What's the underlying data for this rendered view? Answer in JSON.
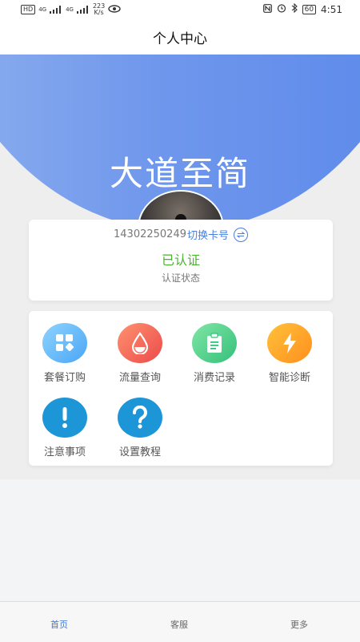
{
  "status_bar": {
    "hd_badge": "HD",
    "net1": "4G",
    "net2": "4G",
    "speed": "223",
    "speed_unit": "K/s",
    "battery": "60",
    "time": "4:51"
  },
  "page_title": "个人中心",
  "hero_title": "大道至简",
  "account": {
    "phone": "14302250249",
    "switch_label": "切换卡号",
    "status_value": "已认证",
    "status_label": "认证状态"
  },
  "menu": [
    {
      "label": "套餐订购",
      "icon": "package-grid-icon",
      "color_from": "#8fd3ff",
      "color_to": "#4aa6f5"
    },
    {
      "label": "流量查询",
      "icon": "water-drop-icon",
      "color_from": "#ff9270",
      "color_to": "#ec4a4a"
    },
    {
      "label": "消费记录",
      "icon": "clipboard-icon",
      "color_from": "#82e6a6",
      "color_to": "#33c07a"
    },
    {
      "label": "智能诊断",
      "icon": "lightning-icon",
      "color_from": "#ffc23a",
      "color_to": "#ff8e1e"
    },
    {
      "label": "注意事项",
      "icon": "exclamation-icon",
      "color_from": "#1d96d8",
      "color_to": "#1d96d8"
    },
    {
      "label": "设置教程",
      "icon": "question-icon",
      "color_from": "#1d96d8",
      "color_to": "#1d96d8"
    }
  ],
  "tabs": [
    {
      "label": "首页"
    },
    {
      "label": "客服"
    },
    {
      "label": "更多"
    }
  ],
  "colors": {
    "accent": "#3a78d8",
    "verified": "#4db232",
    "header_blue": "#5b88ea"
  }
}
